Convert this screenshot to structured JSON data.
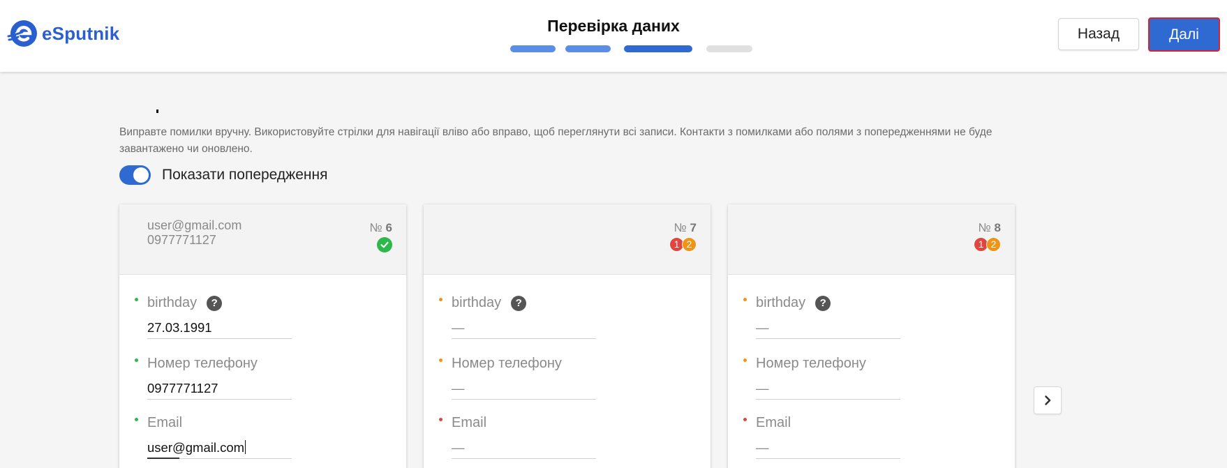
{
  "header": {
    "logo_text": "eSputnik",
    "step_title": "Перевірка даних",
    "back_label": "Назад",
    "next_label": "Далі",
    "progress": {
      "total_steps": 4,
      "current_step": 3
    }
  },
  "main": {
    "info_text": "Виправте помилки вручну. Використовуйте стрілки для навігації вліво або вправо, щоб переглянути всі записи. Контакти з помилками або полями з попередженнями не буде завантажено чи оновлено.",
    "toggle_label": "Показати попередження",
    "toggle_on": true
  },
  "cards": [
    {
      "email": "user@gmail.com",
      "phone": "0977771127",
      "num_prefix": "№",
      "num": "6",
      "status": "valid",
      "fields": [
        {
          "label": "birthday",
          "value": "27.03.1991",
          "state": "ok"
        },
        {
          "label": "Номер телефону",
          "value": "0977771127",
          "state": "ok"
        },
        {
          "label": "Email",
          "value": "user@gmail.com",
          "state": "ok"
        }
      ]
    },
    {
      "email": "",
      "phone": "",
      "num_prefix": "№",
      "num": "7",
      "status": "errors",
      "errors": "1",
      "warnings": "2",
      "fields": [
        {
          "label": "birthday",
          "value": "—",
          "state": "warning"
        },
        {
          "label": "Номер телефону",
          "value": "—",
          "state": "warning"
        },
        {
          "label": "Email",
          "value": "—",
          "state": "error"
        }
      ]
    },
    {
      "email": "",
      "phone": "",
      "num_prefix": "№",
      "num": "8",
      "status": "errors",
      "errors": "1",
      "warnings": "2",
      "fields": [
        {
          "label": "birthday",
          "value": "—",
          "state": "warning"
        },
        {
          "label": "Номер телефону",
          "value": "—",
          "state": "warning"
        },
        {
          "label": "Email",
          "value": "—",
          "state": "error"
        }
      ]
    }
  ],
  "icons": {
    "help": "?",
    "check": "check-icon",
    "chevron": "chevron-right-icon"
  },
  "colors": {
    "accent": "#2f6ad3",
    "ok": "#2db84b",
    "warning": "#f09418",
    "error": "#e0463e",
    "step_done": "#5a8ee6",
    "step_current": "#2f6ad3",
    "step_todo": "#e0e0e0"
  }
}
